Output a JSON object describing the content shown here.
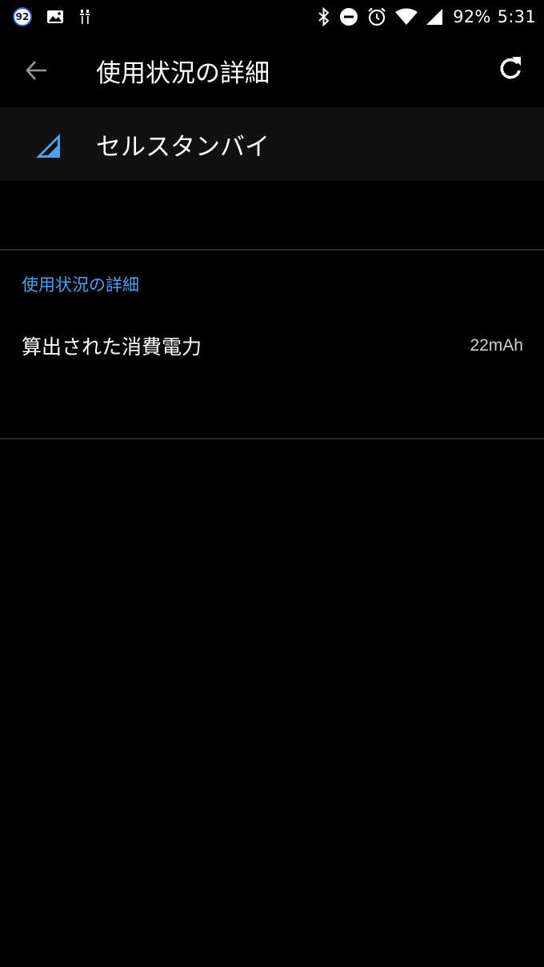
{
  "status_bar": {
    "notification_badge": "92",
    "battery_percent": "92%",
    "time": "5:31",
    "icons": [
      "gallery-icon",
      "usb-icon",
      "bluetooth-icon",
      "do-not-disturb-icon",
      "alarm-icon",
      "wifi-icon",
      "cell-signal-icon"
    ]
  },
  "app_bar": {
    "title": "使用状況の詳細",
    "back_icon": "arrow-back-icon",
    "refresh_icon": "refresh-icon"
  },
  "header": {
    "title": "セルスタンバイ",
    "icon": "cell-signal-icon",
    "accent_color": "#4ba0f0"
  },
  "details": {
    "section_title": "使用状況の詳細",
    "rows": [
      {
        "label": "算出された消費電力",
        "value": "22mAh"
      }
    ]
  }
}
